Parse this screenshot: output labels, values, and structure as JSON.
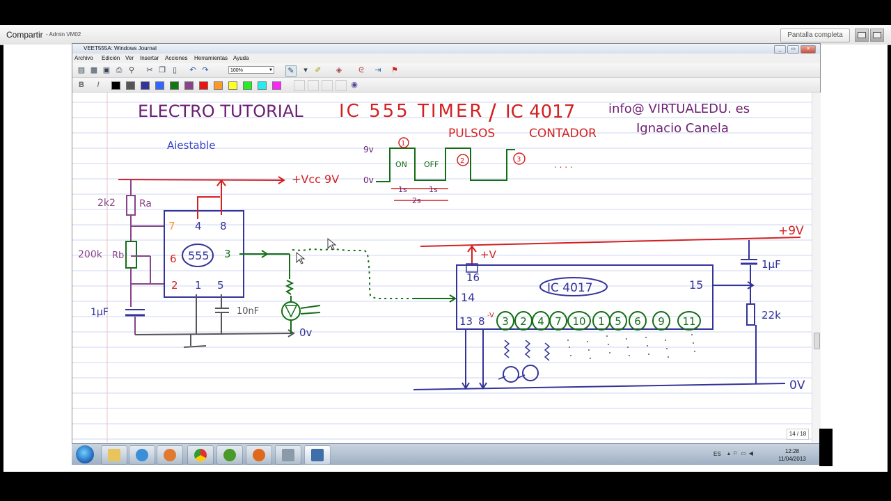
{
  "share": {
    "title": "Compartir",
    "subtitle": "- Admin VM02",
    "fullscreen_label": "Pantalla completa"
  },
  "window": {
    "title": "VEET555A: Windows Journal",
    "min": "_",
    "max": "▭",
    "close": "✕"
  },
  "menu": [
    "Archivo",
    "Edición",
    "Ver",
    "Insertar",
    "Acciones",
    "Herramientas",
    "Ayuda"
  ],
  "toolbar": {
    "zoom": "100%"
  },
  "palette": [
    "#000000",
    "#555555",
    "#333399",
    "#3366ff",
    "#117711",
    "#884488",
    "#ee1111",
    "#ff9922",
    "#ffff22",
    "#22ee22",
    "#22eeee",
    "#ff22ff"
  ],
  "page": {
    "number": "14 / 18"
  },
  "notes": {
    "title": "ELECTRO TUTORIAL",
    "heading": "IC 555 TIMER",
    "slash": "/",
    "heading2": "IC 4017",
    "email": "info@ VIRTUALEDU. es",
    "author": "Ignacio Canela",
    "pulsos": "PULSOS",
    "contador": "CONTADOR",
    "astable": "Aiestable",
    "wave": {
      "v9": "9v",
      "v0": "0v",
      "on": "ON",
      "off": "OFF",
      "n1": "1",
      "n2": "2",
      "n3": "3",
      "dots": ". . . .",
      "t1": "1s",
      "t2": "1s",
      "t3": "2s"
    },
    "c555": {
      "vcc": "+Vcc 9V",
      "r1": "2k2",
      "ra": "Ra",
      "r2": "200k",
      "rb": "Rb",
      "cap": "1µF",
      "cap2": "10nF",
      "chip": "555",
      "p7": "7",
      "p4": "4",
      "p8": "8",
      "p6": "6",
      "p3": "3",
      "p2": "2",
      "p1": "1",
      "p5": "5",
      "gnd": "0v"
    },
    "c4017": {
      "vcc": "+9V",
      "plusv": "+V",
      "chip": "IC 4017",
      "p16": "16",
      "p14": "14",
      "p15": "15",
      "p13": "13",
      "p8": "8",
      "cap": "1µF",
      "res": "22k",
      "gnd": "0V",
      "outputs": [
        "3",
        "2",
        "4",
        "7",
        "10",
        "1",
        "5",
        "6",
        "9",
        "11"
      ]
    }
  },
  "taskbar": {
    "lang": "ES",
    "time": "12:28",
    "date": "11/04/2013"
  }
}
